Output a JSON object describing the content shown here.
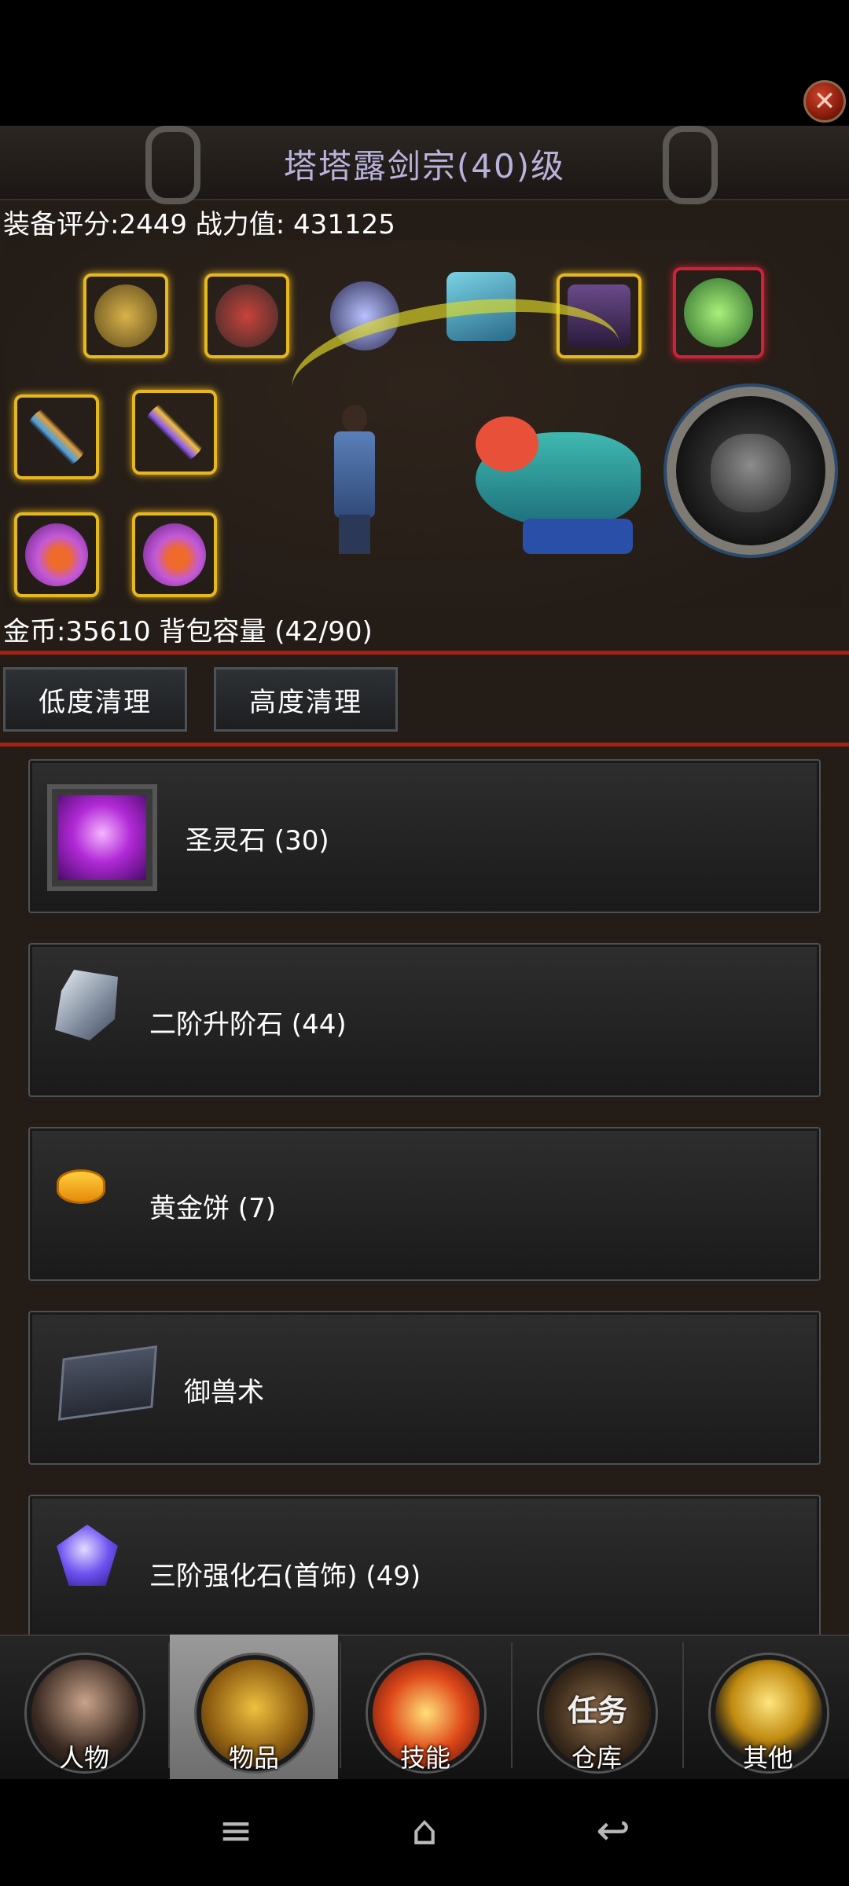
{
  "header": {
    "title": "塔塔露剑宗(40)级",
    "close_icon": "close-icon"
  },
  "stats": {
    "text": "装备评分:2449 战力值: 431125"
  },
  "equipment": {
    "slots": [
      "helmet",
      "armor",
      "necklace",
      "bracer",
      "boots",
      "amulet",
      "weapon",
      "spear",
      "ring-left",
      "ring-right"
    ]
  },
  "wealth": {
    "text": "金币:35610 背包容量 (42/90)"
  },
  "actions": {
    "low_clean": "低度清理",
    "high_clean": "高度清理"
  },
  "items": [
    {
      "name": "圣灵石 (30)",
      "icon": "holy-stone-icon"
    },
    {
      "name": "二阶升阶石 (44)",
      "icon": "upgrade-stone-icon"
    },
    {
      "name": "黄金饼 (7)",
      "icon": "gold-cake-icon"
    },
    {
      "name": "御兽术",
      "icon": "book-icon"
    },
    {
      "name": "三阶强化石(首饰) (49)",
      "icon": "gem-icon"
    }
  ],
  "tabs": [
    {
      "label": "人物",
      "active": false
    },
    {
      "label": "物品",
      "active": true
    },
    {
      "label": "技能",
      "active": false
    },
    {
      "label": "仓库",
      "active": false
    },
    {
      "label": "其他",
      "active": false
    }
  ],
  "tab_overlay": "任务",
  "colors": {
    "divider": "#a4200f",
    "title": "#b9b2dc",
    "slot_gold": "#e6b820",
    "slot_red": "#c9243a"
  }
}
